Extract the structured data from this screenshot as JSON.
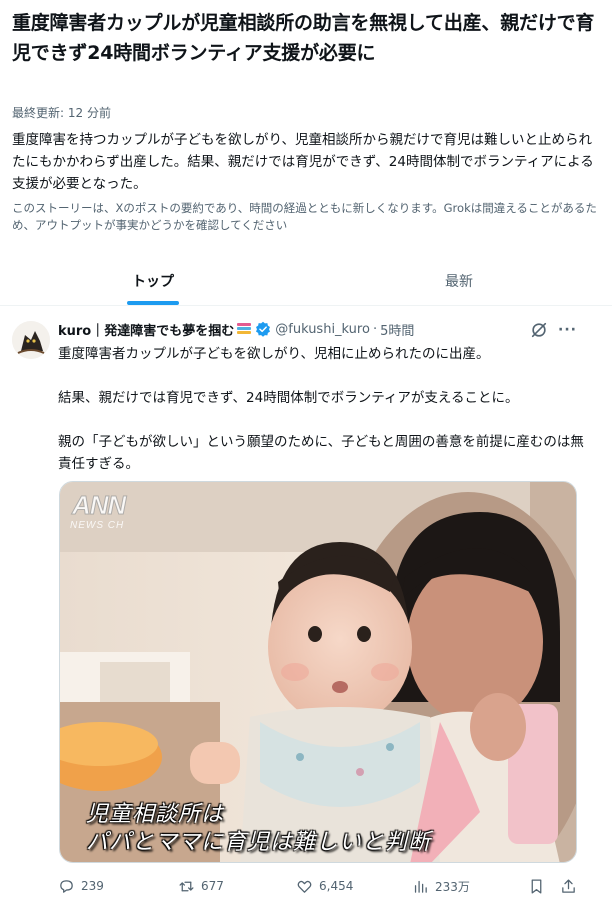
{
  "headline": "重度障害者カップルが児童相談所の助言を無視して出産、親だけで育児できず24時間ボランティア支援が必要に",
  "updated": "最終更新: 12 分前",
  "summary": "重度障害を持つカップルが子どもを欲しがり、児童相談所から親だけで育児は難しいと止められたにもかかわらず出産した。結果、親だけでは育児ができず、24時間体制でボランティアによる支援が必要となった。",
  "disclaimer": "このストーリーは、Xのポストの要約であり、時間の経過とともに新しくなります。Grokは間違えることがあるため、アウトプットが事実かどうかを確認してください",
  "tabs": [
    {
      "label": "トップ",
      "active": true
    },
    {
      "label": "最新",
      "active": false
    }
  ],
  "post": {
    "author": "kuro｜発達障害でも夢を掴む",
    "handle": "@fukushi_kuro",
    "dot": "·",
    "time": "5時間",
    "paragraphs": [
      "重度障害者カップルが子どもを欲しがり、児相に止められたのに出産。",
      "結果、親だけでは育児できず、24時間体制でボランティアが支えることに。",
      "親の「子どもが欲しい」という願望のために、子どもと周囲の善意を前提に産むのは無責任すぎる。"
    ],
    "media": {
      "watermark": "ANN",
      "watermark_sub": "NEWS CH",
      "caption_line1": "児童相談所は",
      "caption_line2": "パパとママに育児は難しいと判断"
    },
    "stats": {
      "replies": "239",
      "reposts": "677",
      "likes": "6,454",
      "views": "233万"
    }
  },
  "colors": {
    "accent": "#1d9bf0",
    "secondary_text": "#536471",
    "border": "#eff3f4"
  }
}
